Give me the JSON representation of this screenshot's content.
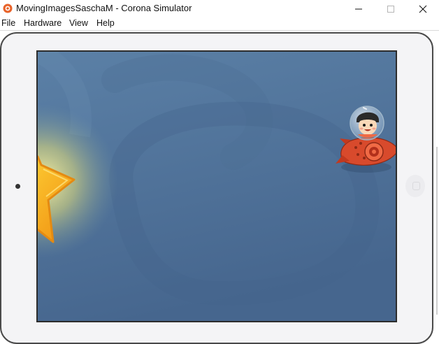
{
  "window": {
    "title": "MovingImagesSaschaM - Corona Simulator",
    "icon": "corona-app-icon",
    "controls": [
      "minimize-icon",
      "maximize-icon",
      "close-icon"
    ]
  },
  "menu": {
    "items": [
      {
        "label": "File"
      },
      {
        "label": "Hardware"
      },
      {
        "label": "View"
      },
      {
        "label": "Help"
      }
    ]
  },
  "simulator": {
    "device": "tablet-landscape",
    "scene": {
      "background_color": "#4f7196",
      "sprites": [
        "star-sprite",
        "astronaut-rocket-sprite"
      ]
    }
  },
  "colors": {
    "accent": "#e8632a",
    "star": "#f5b417",
    "rocket": "#d84a2c"
  }
}
